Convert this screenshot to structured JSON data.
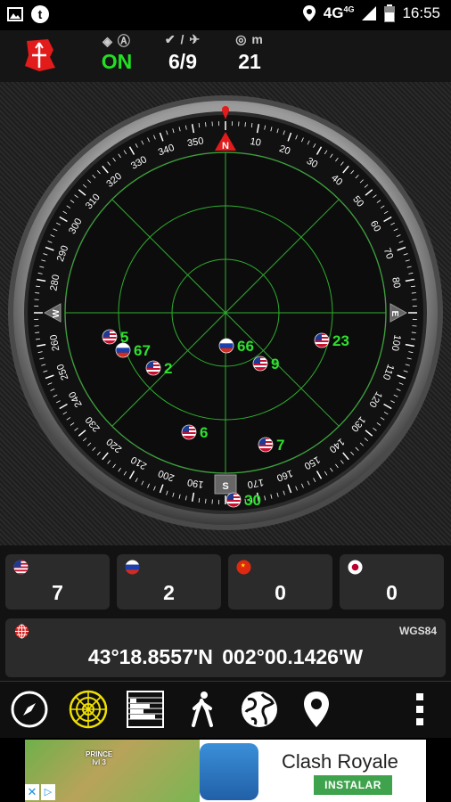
{
  "status_bar": {
    "network": "4G",
    "network_sup": "4G",
    "time": "16:55",
    "icons": [
      "image-icon",
      "tumblr-icon",
      "location-icon",
      "signal-icon",
      "battery-icon"
    ]
  },
  "header": {
    "gps_status": "ON",
    "used_count": "6",
    "visible_count": "9",
    "accuracy": "21",
    "accuracy_unit": "m",
    "status_color": "#22e022"
  },
  "compass": {
    "north": "N",
    "south": "S",
    "east": "E",
    "west": "W",
    "degrees": [
      "10",
      "20",
      "30",
      "40",
      "50",
      "60",
      "70",
      "80",
      "100",
      "110",
      "120",
      "130",
      "140",
      "150",
      "160",
      "170",
      "190",
      "200",
      "210",
      "220",
      "230",
      "240",
      "250",
      "260",
      "280",
      "290",
      "300",
      "310",
      "320",
      "330",
      "340",
      "350"
    ]
  },
  "satellites": [
    {
      "id": "5",
      "flag": "us"
    },
    {
      "id": "67",
      "flag": "ru"
    },
    {
      "id": "2",
      "flag": "us"
    },
    {
      "id": "66",
      "flag": "ru"
    },
    {
      "id": "9",
      "flag": "us"
    },
    {
      "id": "23",
      "flag": "us"
    },
    {
      "id": "6",
      "flag": "us"
    },
    {
      "id": "7",
      "flag": "us"
    },
    {
      "id": "30",
      "flag": "us"
    }
  ],
  "constellations": [
    {
      "flag": "us",
      "count": "7"
    },
    {
      "flag": "ru",
      "count": "2"
    },
    {
      "flag": "cn",
      "count": "0"
    },
    {
      "flag": "jp",
      "count": "0"
    }
  ],
  "location": {
    "datum": "WGS84",
    "latitude": "43°18.8557'N",
    "longitude": "002°00.1426'W"
  },
  "toolbar": {
    "buttons": [
      "compass-icon",
      "radar-icon",
      "signal-bars-icon",
      "walk-icon",
      "globe-icon",
      "map-pin-icon",
      "overflow-menu-icon"
    ]
  },
  "ad": {
    "title": "Clash Royale",
    "cta": "INSTALAR",
    "game_label": "PRINCE",
    "game_level": "lvl 3"
  }
}
